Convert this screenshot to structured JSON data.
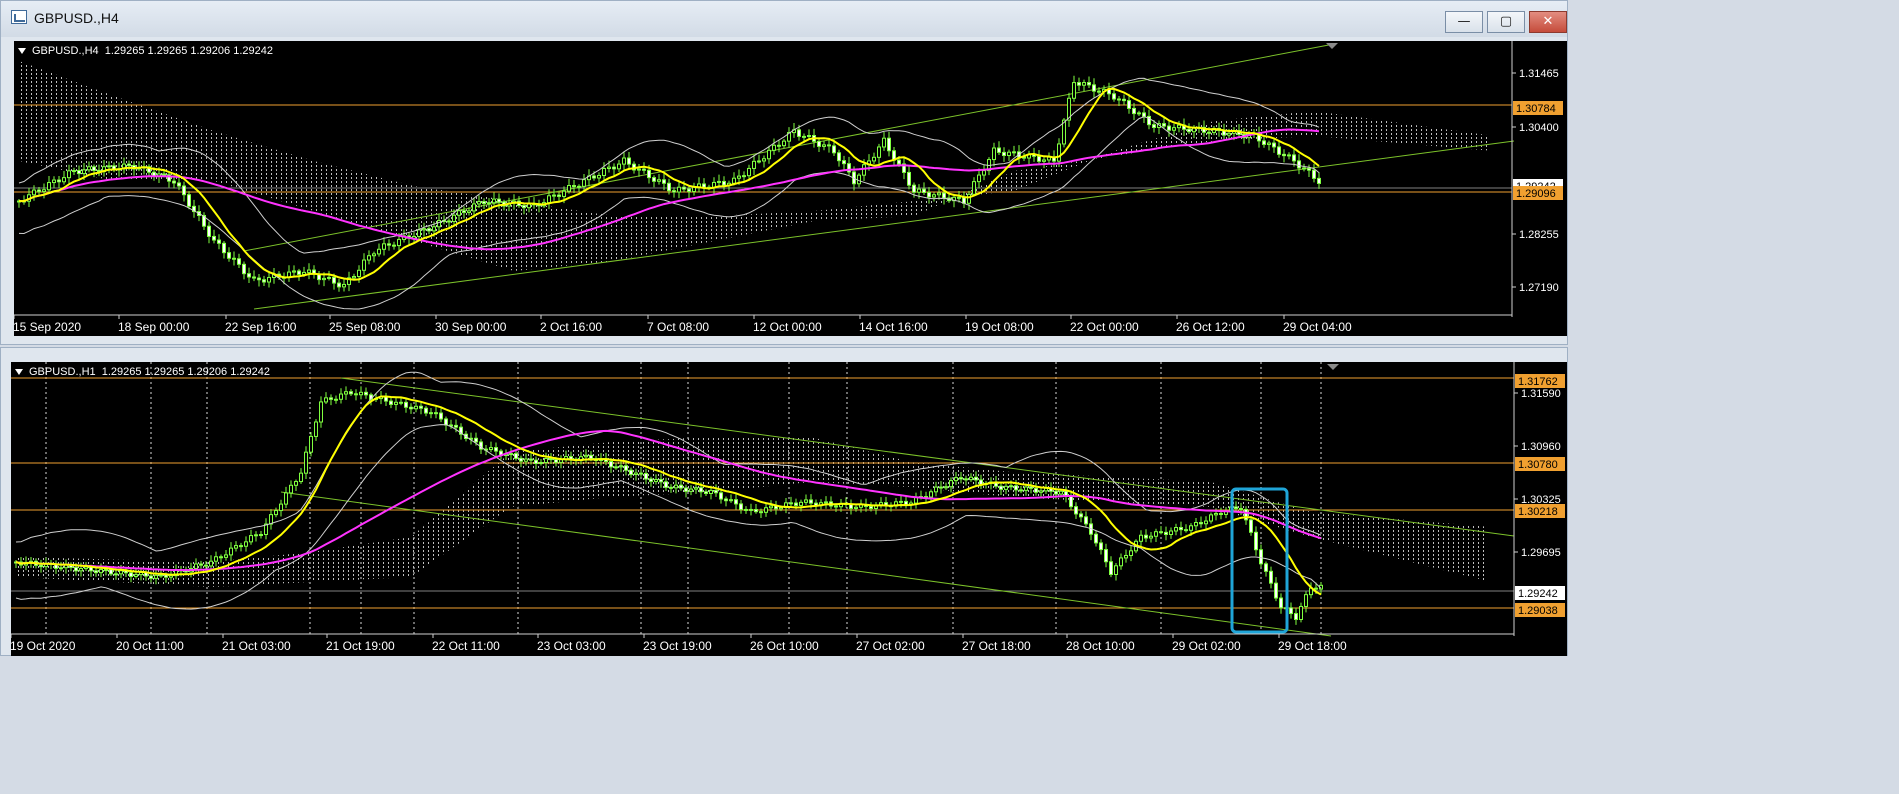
{
  "top_window": {
    "title": "GBPUSD.,H4",
    "buttons": {
      "minimize": "—",
      "maximize": "▢",
      "close": "✕"
    },
    "info": "GBPUSD.,H4  1.29265 1.29265 1.29206 1.29242",
    "price_labels": [
      "1.31465",
      "1.30400",
      "1.28255",
      "1.27190"
    ],
    "price_tags": [
      {
        "text": "1.30784",
        "color": "#f0a030"
      },
      {
        "text": "1.29242",
        "color": "#ffffff"
      },
      {
        "text": "1.29096",
        "color": "#f0a030"
      }
    ],
    "time_labels": [
      "15 Sep 2020",
      "18 Sep 00:00",
      "22 Sep 16:00",
      "25 Sep 08:00",
      "30 Sep 00:00",
      "2 Oct 16:00",
      "7 Oct 08:00",
      "12 Oct 00:00",
      "14 Oct 16:00",
      "19 Oct 08:00",
      "22 Oct 00:00",
      "26 Oct 12:00",
      "29 Oct 04:00"
    ]
  },
  "bottom_window": {
    "info": "GBPUSD.,H1  1.29265 1.29265 1.29206 1.29242",
    "price_labels": [
      "1.31590",
      "1.30960",
      "1.30325",
      "1.29695"
    ],
    "price_tags": [
      {
        "text": "1.31762",
        "color": "#f0a030"
      },
      {
        "text": "1.30780",
        "color": "#f0a030"
      },
      {
        "text": "1.30218",
        "color": "#f0a030"
      },
      {
        "text": "1.29242",
        "color": "#ffffff"
      },
      {
        "text": "1.29038",
        "color": "#f0a030"
      }
    ],
    "time_labels": [
      "19 Oct 2020",
      "20 Oct 11:00",
      "21 Oct 03:00",
      "21 Oct 19:00",
      "22 Oct 11:00",
      "23 Oct 03:00",
      "23 Oct 19:00",
      "26 Oct 10:00",
      "27 Oct 02:00",
      "27 Oct 18:00",
      "28 Oct 10:00",
      "29 Oct 02:00",
      "29 Oct 18:00"
    ]
  },
  "colors": {
    "background": "#000000",
    "candle": "#7fff3f",
    "ma_fast": "#ffff00",
    "ma_slow": "#ff33ff",
    "bands": "#cfcfcf",
    "trendline": "#7cc22a",
    "level": "#f0a030",
    "highlight_box": "#1fa5d8"
  }
}
